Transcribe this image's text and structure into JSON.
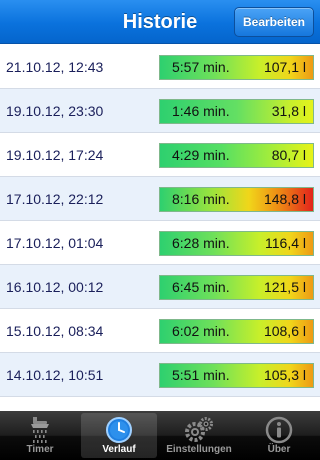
{
  "navbar": {
    "title": "Historie",
    "edit_label": "Bearbeiten"
  },
  "history": [
    {
      "date": "21.10.12, 12:43",
      "duration": "5:57 min.",
      "volume": "107,1 l"
    },
    {
      "date": "19.10.12, 23:30",
      "duration": "1:46 min.",
      "volume": "31,8 l"
    },
    {
      "date": "19.10.12, 17:24",
      "duration": "4:29 min.",
      "volume": "80,7 l"
    },
    {
      "date": "17.10.12, 22:12",
      "duration": "8:16 min.",
      "volume": "148,8 l"
    },
    {
      "date": "17.10.12, 01:04",
      "duration": "6:28 min.",
      "volume": "116,4 l"
    },
    {
      "date": "16.10.12, 00:12",
      "duration": "6:45 min.",
      "volume": "121,5 l"
    },
    {
      "date": "15.10.12, 08:34",
      "duration": "6:02 min.",
      "volume": "108,6 l"
    },
    {
      "date": "14.10.12, 10:51",
      "duration": "5:51 min.",
      "volume": "105,3 l"
    }
  ],
  "tabs": [
    {
      "label": "Timer",
      "icon": "shower-icon"
    },
    {
      "label": "Verlauf",
      "icon": "clock-icon"
    },
    {
      "label": "Einstellungen",
      "icon": "gears-icon"
    },
    {
      "label": "Über",
      "icon": "info-icon"
    }
  ],
  "colors": {
    "navbar": "#0a72dd",
    "row_alt": "#e9f1fb",
    "bar_low": "#2ed06f",
    "bar_high": "#e2231c"
  }
}
